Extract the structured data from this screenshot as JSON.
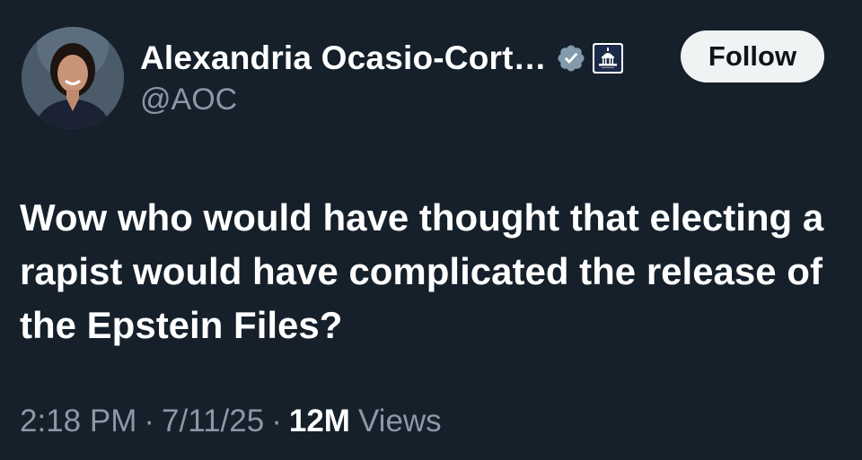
{
  "author": {
    "display_name": "Alexandria Ocasio-Cort…",
    "handle": "@AOC",
    "verified_icon": "verified-badge-icon",
    "affiliation_icon": "capitol-building-icon"
  },
  "follow_label": "Follow",
  "tweet": {
    "text": "Wow who would have thought that electing a rapist would have complicated the release of the Epstein Files?"
  },
  "meta": {
    "time": "2:18 PM",
    "separator": "·",
    "date": "7/11/25",
    "views_count": "12M",
    "views_label": "Views"
  },
  "colors": {
    "background": "#15202b",
    "text_primary": "#ffffff",
    "text_secondary": "#8b98a5",
    "follow_bg": "#eff3f4",
    "verified_badge": "#829aab"
  }
}
